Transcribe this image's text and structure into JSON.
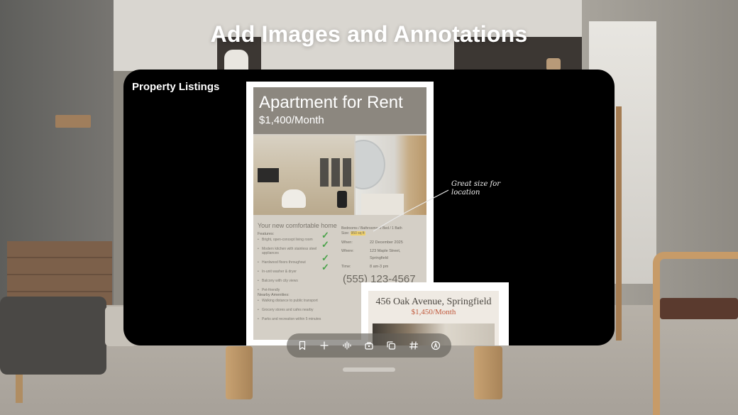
{
  "page": {
    "title": "Add Images and Annotations"
  },
  "window": {
    "title": "Property Listings"
  },
  "flyer": {
    "title": "Apartment for Rent",
    "price": "$1,400/Month",
    "home_heading": "Your new comfortable home",
    "features_label": "Features:",
    "features": [
      "Bright, open-concept living room",
      "Modern kitchen with stainless steel appliances",
      "Hardwood floors throughout",
      "In-unit washer & dryer",
      "Balcony with city views",
      "Pet-friendly"
    ],
    "bedrooms": "Bedrooms / Bathrooms: 2 Bed / 1 Bath",
    "size_label": "Size:",
    "size_value": "950 sq ft",
    "when_label": "When:",
    "when_value": "22 December 2025",
    "where_label": "Where:",
    "where_line1": "123 Maple Street,",
    "where_line2": "Springfield",
    "time_label": "Time:",
    "time_value": "8 am-3 pm",
    "phone": "(555) 123-4567",
    "nearby_label": "Nearby Amenities:",
    "nearby": [
      "Walking distance to public transport",
      "Grocery stores and cafes nearby",
      "Parks and recreation within 5 minutes"
    ]
  },
  "annotation": {
    "line1": "Great size for",
    "line2": "location"
  },
  "flyer2": {
    "title": "456 Oak Avenue, Springfield",
    "price": "$1,450/Month"
  },
  "toolbar": {
    "buttons": [
      "bookmark-icon",
      "plus-icon",
      "audio-waveform-icon",
      "lock-briefcase-icon",
      "copy-pages-icon",
      "number-sign-icon",
      "markup-pen-icon"
    ]
  },
  "colors": {
    "flyer_header": "#8c877f",
    "highlight": "#f1d26b",
    "check": "#4aa34a",
    "price_accent": "#c0593c"
  }
}
